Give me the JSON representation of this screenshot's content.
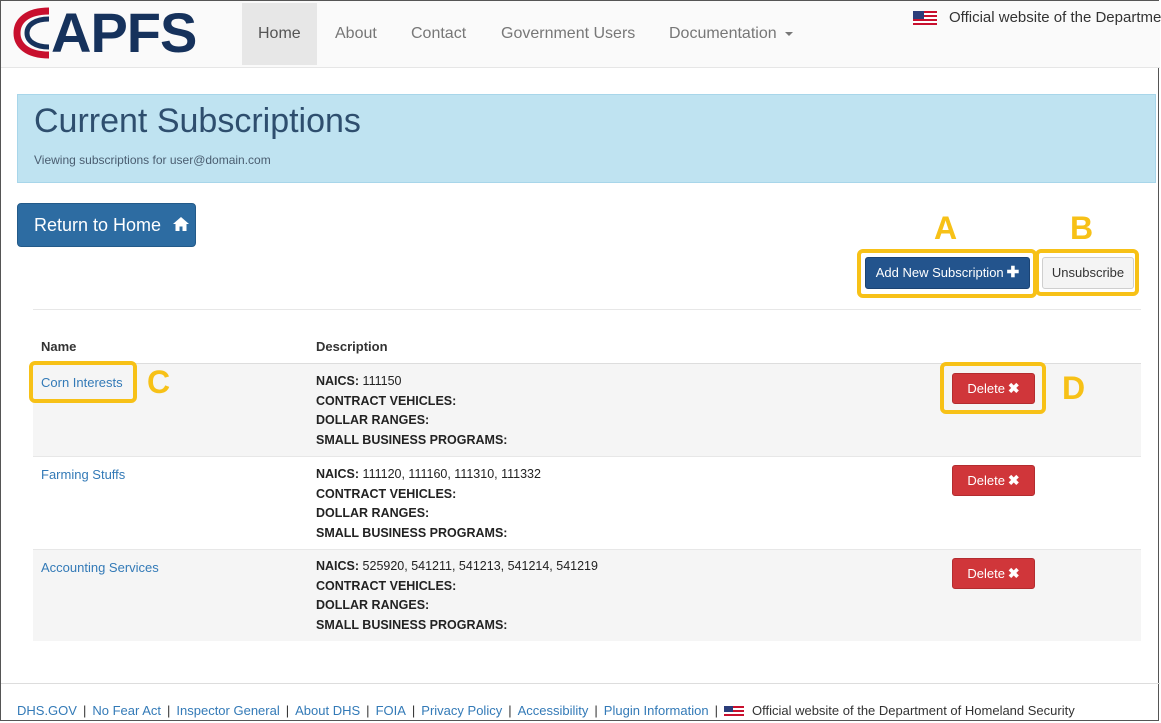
{
  "brand": {
    "logo_text": "APFS"
  },
  "nav": {
    "items": [
      {
        "label": "Home"
      },
      {
        "label": "About"
      },
      {
        "label": "Contact"
      },
      {
        "label": "Government Users"
      },
      {
        "label": "Documentation"
      }
    ],
    "official_text": "Official website of the Department of Homeland Security"
  },
  "header": {
    "title": "Current Subscriptions",
    "subtitle": "Viewing subscriptions for user@domain.com"
  },
  "actions": {
    "return_home": "Return to Home",
    "add_subscription": "Add New Subscription",
    "unsubscribe": "Unsubscribe"
  },
  "annotations": [
    "A",
    "B",
    "C",
    "D"
  ],
  "table": {
    "headers": [
      "Name",
      "Description"
    ],
    "field_labels": {
      "naics": "NAICS:",
      "vehicles": "CONTRACT VEHICLES:",
      "dollars": "DOLLAR RANGES:",
      "programs": "SMALL BUSINESS PROGRAMS:"
    },
    "delete_label": "Delete",
    "rows": [
      {
        "name": "Corn Interests",
        "naics": "111150"
      },
      {
        "name": "Farming Stuffs",
        "naics": "111120, 111160, 111310, 111332"
      },
      {
        "name": "Accounting Services",
        "naics": "525920, 541211, 541213, 541214, 541219"
      }
    ]
  },
  "footer": {
    "links": [
      "DHS.GOV",
      "No Fear Act",
      "Inspector General",
      "About DHS",
      "FOIA",
      "Privacy Policy",
      "Accessibility",
      "Plugin Information"
    ],
    "official_text": "Official website of the Department of Homeland Security"
  },
  "colors": {
    "highlight": "#f7c117",
    "primary": "#2d6ca2",
    "danger": "#d0363a",
    "header_bg": "#bfe3f1"
  }
}
